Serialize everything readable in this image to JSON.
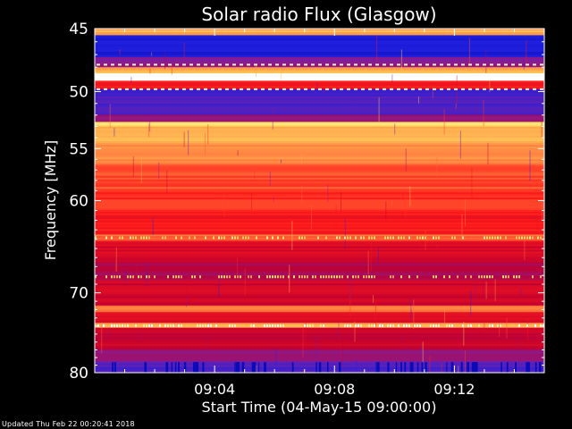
{
  "chart_data": {
    "type": "heatmap",
    "title": "Solar radio Flux (Glasgow)",
    "xlabel": "Start Time (04-May-15 09:00:00)",
    "ylabel": "Frequency [MHz]",
    "x_unit": "time",
    "xlim": [
      "09:00:00",
      "09:15:00"
    ],
    "ylim": [
      45,
      80
    ],
    "y_scale": "log",
    "y_inverted": true,
    "x_ticks": [
      {
        "value": "09:04",
        "minutes": 4
      },
      {
        "value": "09:08",
        "minutes": 8
      },
      {
        "value": "09:12",
        "minutes": 12
      }
    ],
    "y_ticks": [
      45,
      50,
      55,
      60,
      70,
      80
    ],
    "colormap": [
      "#0000a0",
      "#2020e0",
      "#8020a0",
      "#c00030",
      "#ff1a1a",
      "#ff8040",
      "#ffe060",
      "#ffffff"
    ],
    "bands": [
      {
        "from": 45.0,
        "to": 45.5,
        "level": 0.78
      },
      {
        "from": 45.5,
        "to": 47.2,
        "level": 0.12
      },
      {
        "from": 47.2,
        "to": 48.0,
        "level": 0.3
      },
      {
        "from": 48.0,
        "to": 48.5,
        "level": 0.78
      },
      {
        "from": 48.5,
        "to": 49.1,
        "level": 1.0
      },
      {
        "from": 49.1,
        "to": 49.8,
        "level": 0.55
      },
      {
        "from": 49.8,
        "to": 51.0,
        "level": 0.2
      },
      {
        "from": 51.0,
        "to": 52.0,
        "level": 0.22
      },
      {
        "from": 52.0,
        "to": 52.6,
        "level": 0.35
      },
      {
        "from": 52.6,
        "to": 53.0,
        "level": 0.85
      },
      {
        "from": 53.0,
        "to": 54.5,
        "level": 0.8
      },
      {
        "from": 54.5,
        "to": 56.5,
        "level": 0.72
      },
      {
        "from": 56.5,
        "to": 59.0,
        "level": 0.64
      },
      {
        "from": 59.0,
        "to": 61.5,
        "level": 0.6
      },
      {
        "from": 61.5,
        "to": 63.5,
        "level": 0.56
      },
      {
        "from": 63.5,
        "to": 64.2,
        "level": 0.68
      },
      {
        "from": 64.2,
        "to": 66.5,
        "level": 0.48
      },
      {
        "from": 66.5,
        "to": 68.5,
        "level": 0.4
      },
      {
        "from": 68.5,
        "to": 71.5,
        "level": 0.46
      },
      {
        "from": 71.5,
        "to": 72.3,
        "level": 0.7
      },
      {
        "from": 72.3,
        "to": 73.6,
        "level": 0.5
      },
      {
        "from": 73.6,
        "to": 74.2,
        "level": 0.76
      },
      {
        "from": 74.2,
        "to": 77.0,
        "level": 0.44
      },
      {
        "from": 77.0,
        "to": 78.5,
        "level": 0.34
      },
      {
        "from": 78.5,
        "to": 80.0,
        "level": 0.22
      }
    ]
  },
  "footer": {
    "updated": "Updated Thu Feb 22 00:20:41 2018"
  }
}
